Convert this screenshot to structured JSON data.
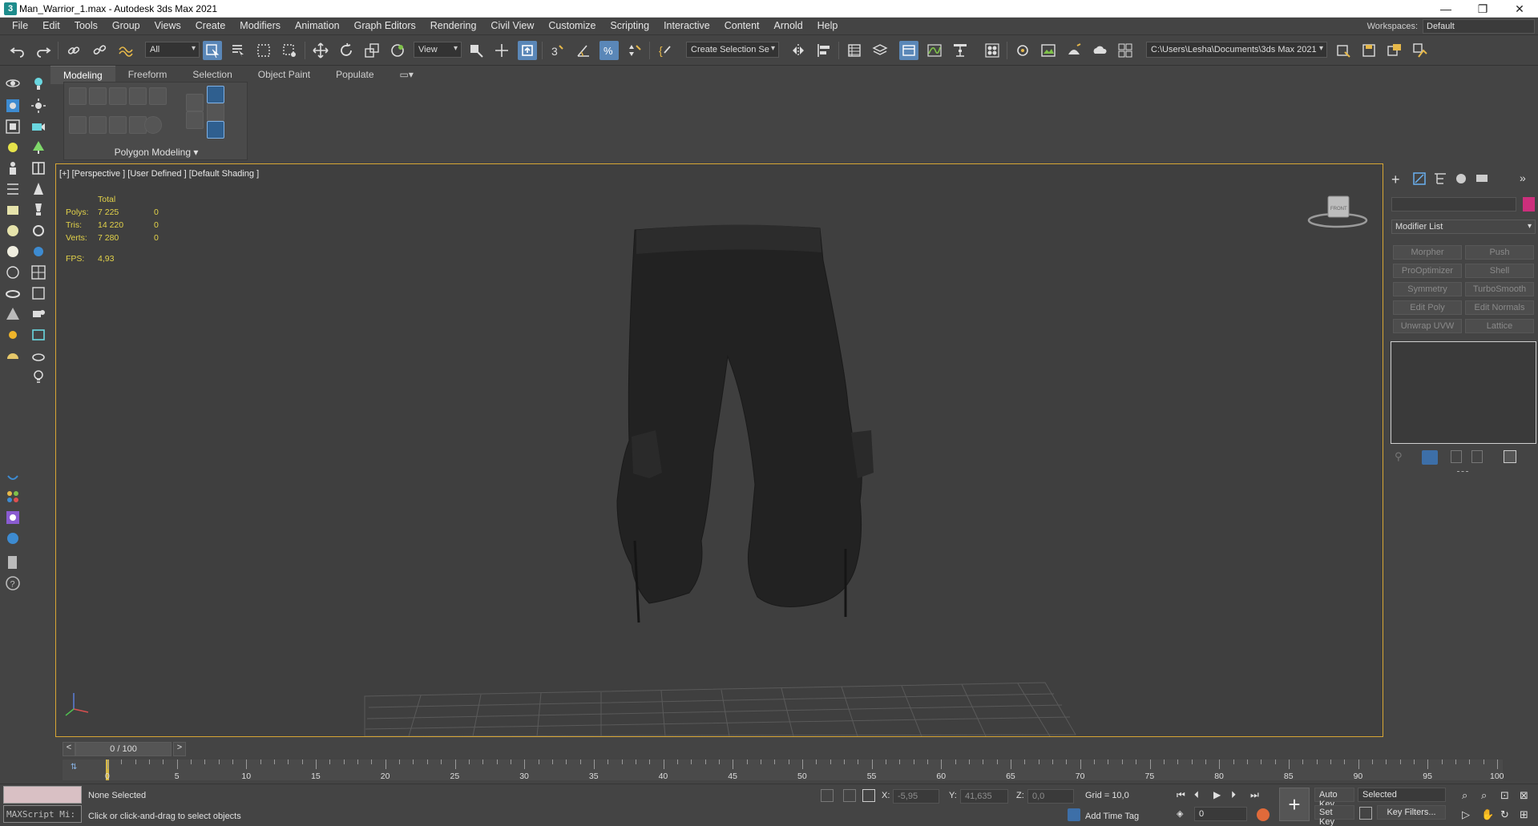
{
  "window": {
    "title": "Man_Warrior_1.max - Autodesk 3ds Max 2021",
    "controls": [
      "—",
      "❐",
      "✕"
    ]
  },
  "menubar": {
    "items": [
      "File",
      "Edit",
      "Tools",
      "Group",
      "Views",
      "Create",
      "Modifiers",
      "Animation",
      "Graph Editors",
      "Rendering",
      "Civil View",
      "Customize",
      "Scripting",
      "Interactive",
      "Content",
      "Arnold",
      "Help"
    ],
    "workspaces_label": "Workspaces:",
    "workspace_value": "Default"
  },
  "toolbar": {
    "selection_filter": "All",
    "ref_coord": "View",
    "named_selection": "Create Selection Se",
    "project_path": "C:\\Users\\Lesha\\Documents\\3ds Max 2021"
  },
  "ribbon": {
    "tabs": [
      "Modeling",
      "Freeform",
      "Selection",
      "Object Paint",
      "Populate"
    ],
    "active_tab": "Modeling",
    "panel_label": "Polygon Modeling ▾"
  },
  "viewport": {
    "label": "[+] [Perspective ] [User Defined ] [Default Shading ]",
    "stats": {
      "header": "Total",
      "rows": [
        {
          "key": "Polys:",
          "value": "7 225",
          "sel": "0"
        },
        {
          "key": "Tris:",
          "value": "14 220",
          "sel": "0"
        },
        {
          "key": "Verts:",
          "value": "7 280",
          "sel": "0"
        }
      ],
      "fps_label": "FPS:",
      "fps_value": "4,93"
    },
    "viewcube_face": "FRONT",
    "colors": {
      "border": "#d8a634",
      "stats_text": "#e3d34a"
    }
  },
  "command_panel": {
    "modifier_list": "Modifier List",
    "object_color": "#cc2f7c",
    "modifier_buttons": [
      "Morpher",
      "Push",
      "ProOptimizer",
      "Shell",
      "Symmetry",
      "TurboSmooth",
      "Edit Poly",
      "Edit Normals",
      "Unwrap UVW",
      "Lattice"
    ]
  },
  "timeline": {
    "frame_display": "0 / 100",
    "prev": "<",
    "next": ">",
    "ticks": [
      "0",
      "5",
      "10",
      "15",
      "20",
      "25",
      "30",
      "35",
      "40",
      "45",
      "50",
      "55",
      "60",
      "65",
      "70",
      "75",
      "80",
      "85",
      "90",
      "95",
      "100"
    ]
  },
  "statusbar": {
    "maxscript_placeholder": "MAXScript Mi:",
    "selection_status": "None Selected",
    "prompt": "Click or click-and-drag to select objects",
    "x_label": "X:",
    "x_value": "-5,95",
    "y_label": "Y:",
    "y_value": "41,635",
    "z_label": "Z:",
    "z_value": "0,0",
    "grid": "Grid = 10,0",
    "add_time_tag": "Add Time Tag",
    "auto_key": "Auto Key",
    "set_key": "Set Key",
    "key_mode": "Selected",
    "key_filters": "Key Filters...",
    "current_frame": "0"
  }
}
